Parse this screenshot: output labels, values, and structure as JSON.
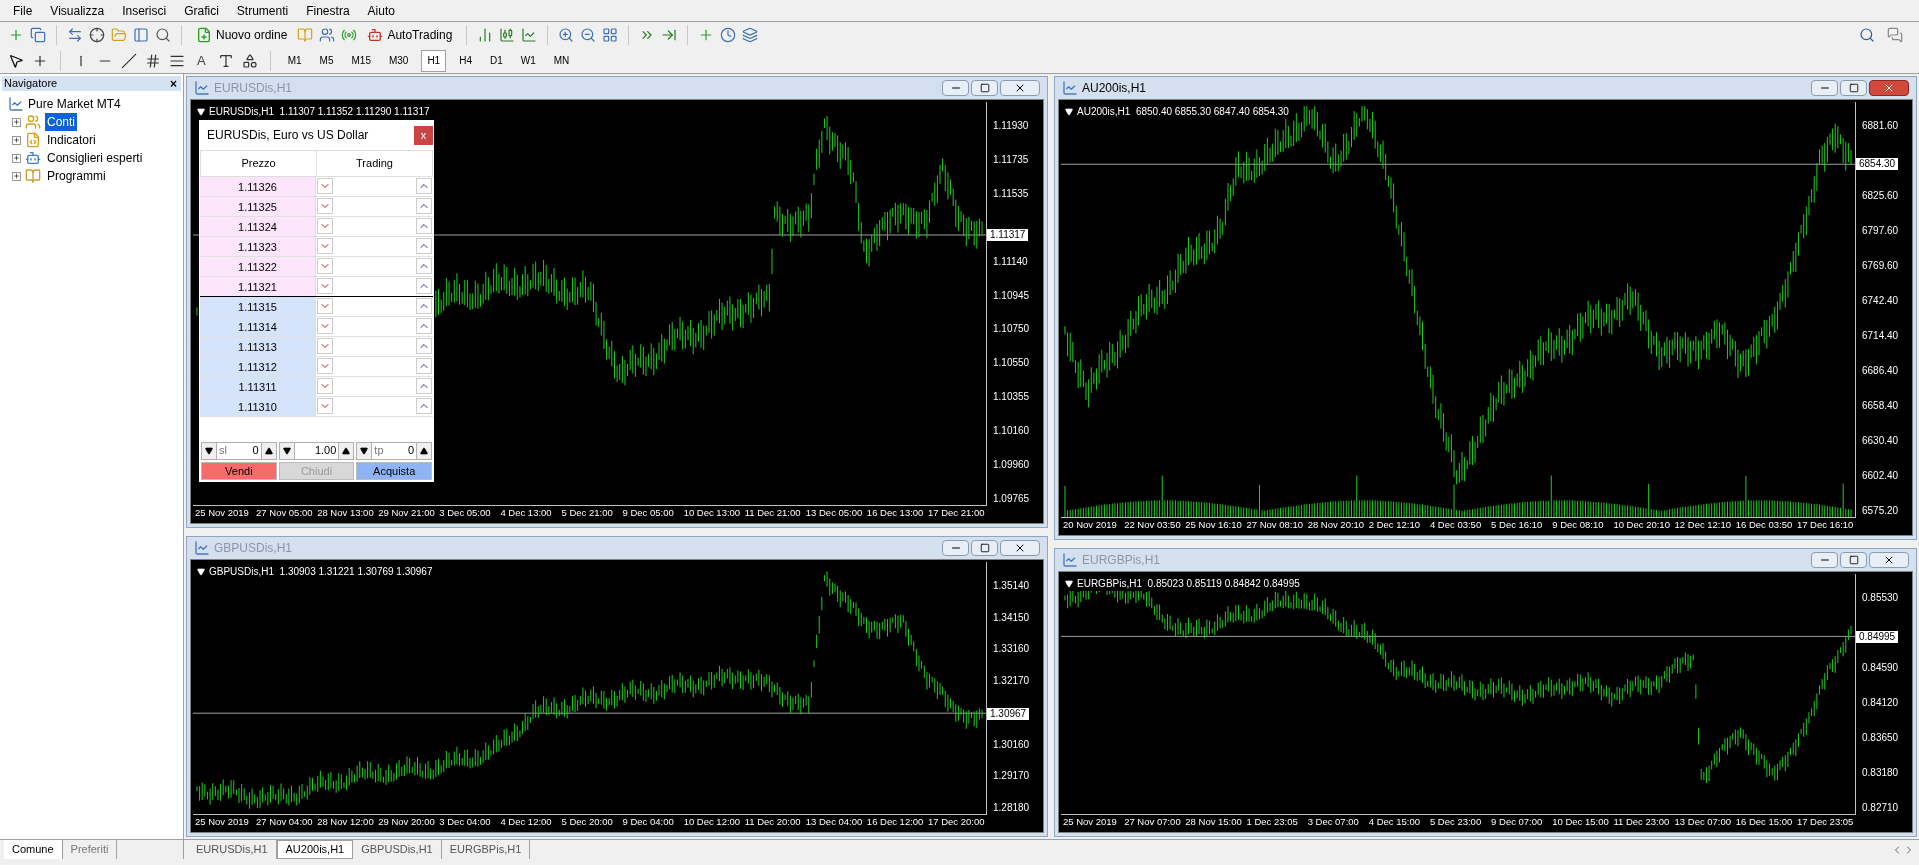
{
  "menu": [
    "File",
    "Visualizza",
    "Inserisci",
    "Grafici",
    "Strumenti",
    "Finestra",
    "Aiuto"
  ],
  "toolbar": {
    "buttons": [
      {
        "label": "Nuovo ordine",
        "kind": "order"
      },
      {
        "label": "AutoTrading",
        "kind": "auto"
      }
    ]
  },
  "drawing_tools": {
    "text_tool": "A"
  },
  "timeframes": [
    {
      "label": "M1",
      "selected": false
    },
    {
      "label": "M5",
      "selected": false
    },
    {
      "label": "M15",
      "selected": false
    },
    {
      "label": "M30",
      "selected": false
    },
    {
      "label": "H1",
      "selected": true
    },
    {
      "label": "H4",
      "selected": false
    },
    {
      "label": "D1",
      "selected": false
    },
    {
      "label": "W1",
      "selected": false
    },
    {
      "label": "MN",
      "selected": false
    }
  ],
  "navigator": {
    "title": "Navigatore",
    "close": "×",
    "root": "Pure Market MT4",
    "items": [
      {
        "label": "Conti",
        "kind": "accounts",
        "selected": true,
        "expanded": false
      },
      {
        "label": "Indicatori",
        "kind": "indicators",
        "selected": false,
        "expanded": false
      },
      {
        "label": "Consiglieri esperti",
        "kind": "experts",
        "selected": false,
        "expanded": false
      },
      {
        "label": "Programmi",
        "kind": "scripts",
        "selected": false,
        "expanded": false
      }
    ],
    "tabs": [
      {
        "label": "Comune",
        "selected": true
      },
      {
        "label": "Preferiti",
        "selected": false
      }
    ]
  },
  "windows": [
    {
      "title": "EURUSDis,H1",
      "active": false,
      "header": "EURUSDis,H1  1.11307 1.11352 1.11290 1.11317",
      "current_price": "1.11317",
      "price_axis": [
        "1.11930",
        "1.11735",
        "1.11535",
        "1.11140",
        "1.10945",
        "1.10750",
        "1.10550",
        "1.10355",
        "1.10160",
        "1.09960",
        "1.09765"
      ],
      "time_axis": [
        "25 Nov 2019",
        "27 Nov 05:00",
        "28 Nov 13:00",
        "29 Nov 21:00",
        "3 Dec 05:00",
        "4 Dec 13:00",
        "5 Dec 21:00",
        "9 Dec 05:00",
        "10 Dec 13:00",
        "11 Dec 21:00",
        "13 Dec 05:00",
        "16 Dec 13:00",
        "17 Dec 21:00"
      ]
    },
    {
      "title": "AU200is,H1",
      "active": true,
      "header": "AU200is,H1  6850.40 6855.30 6847.40 6854.30",
      "current_price": "6854.30",
      "price_axis": [
        "6881.60",
        "6825.60",
        "6797.60",
        "6769.60",
        "6742.40",
        "6714.40",
        "6686.40",
        "6658.40",
        "6630.40",
        "6602.40",
        "6575.20"
      ],
      "time_axis": [
        "20 Nov 2019",
        "22 Nov 03:50",
        "25 Nov 16:10",
        "27 Nov 08:10",
        "28 Nov 20:10",
        "2 Dec 12:10",
        "4 Dec 03:50",
        "5 Dec 16:10",
        "9 Dec 08:10",
        "10 Dec 20:10",
        "12 Dec 12:10",
        "16 Dec 03:50",
        "17 Dec 16:10"
      ]
    },
    {
      "title": "GBPUSDis,H1",
      "active": false,
      "header": "GBPUSDis,H1  1.30903 1.31221 1.30769 1.30967",
      "current_price": "1.30967",
      "price_axis": [
        "1.35140",
        "1.34150",
        "1.33160",
        "1.32170",
        "1.30160",
        "1.29170",
        "1.28180"
      ],
      "time_axis": [
        "25 Nov 2019",
        "27 Nov 04:00",
        "28 Nov 12:00",
        "29 Nov 20:00",
        "3 Dec 04:00",
        "4 Dec 12:00",
        "5 Dec 20:00",
        "9 Dec 04:00",
        "10 Dec 12:00",
        "11 Dec 20:00",
        "13 Dec 04:00",
        "16 Dec 12:00",
        "17 Dec 20:00"
      ]
    },
    {
      "title": "EURGBPis,H1",
      "active": false,
      "header": "EURGBPis,H1  0.85023 0.85119 0.84842 0.84995",
      "current_price": "0.84995",
      "price_axis": [
        "0.85530",
        "0.84590",
        "0.84120",
        "0.83650",
        "0.83180",
        "0.82710"
      ],
      "time_axis": [
        "25 Nov 2019",
        "27 Nov 07:00",
        "28 Nov 15:00",
        "1 Dec 23:05",
        "3 Dec 07:00",
        "4 Dec 15:00",
        "5 Dec 23:00",
        "9 Dec 07:00",
        "10 Dec 15:00",
        "11 Dec 23:00",
        "13 Dec 07:00",
        "16 Dec 15:00",
        "17 Dec 23:05"
      ]
    }
  ],
  "one_click": {
    "title": "EURUSDis, Euro vs US Dollar",
    "close": "x",
    "columns": [
      "Prezzo",
      "Trading"
    ],
    "rows": [
      {
        "price": "1.11326",
        "kind": "ask"
      },
      {
        "price": "1.11325",
        "kind": "ask"
      },
      {
        "price": "1.11324",
        "kind": "ask"
      },
      {
        "price": "1.11323",
        "kind": "ask"
      },
      {
        "price": "1.11322",
        "kind": "ask"
      },
      {
        "price": "1.11321",
        "kind": "ask"
      },
      {
        "price": "1.11315",
        "kind": "bid"
      },
      {
        "price": "1.11314",
        "kind": "bid"
      },
      {
        "price": "1.11313",
        "kind": "bid"
      },
      {
        "price": "1.11312",
        "kind": "bid"
      },
      {
        "price": "1.11311",
        "kind": "bid"
      },
      {
        "price": "1.11310",
        "kind": "bid"
      }
    ],
    "sl": {
      "label": "sl",
      "value": "0"
    },
    "volume": {
      "value": "1.00"
    },
    "tp": {
      "label": "tp",
      "value": "0"
    },
    "buttons": [
      {
        "label": "Vendi",
        "kind": "sell",
        "disabled": false
      },
      {
        "label": "Chiudi",
        "kind": "close",
        "disabled": true
      },
      {
        "label": "Acquista",
        "kind": "buy",
        "disabled": false
      }
    ]
  },
  "chart_tabs": [
    {
      "label": "EURUSDis,H1",
      "selected": false
    },
    {
      "label": "AU200is,H1",
      "selected": true
    },
    {
      "label": "GBPUSDis,H1",
      "selected": false
    },
    {
      "label": "EURGBPis,H1",
      "selected": false
    }
  ]
}
